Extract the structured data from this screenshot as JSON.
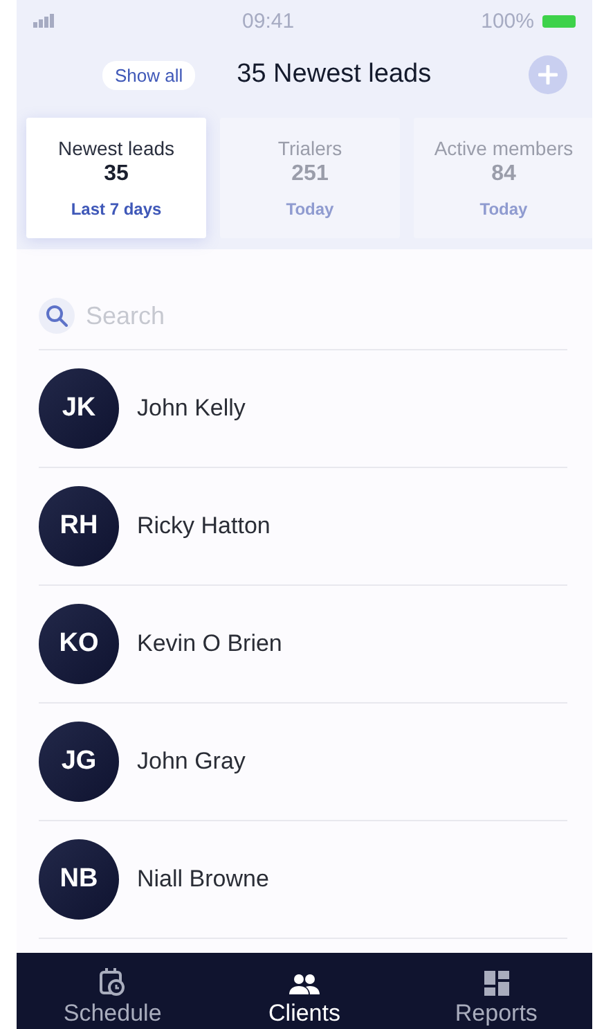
{
  "status_bar": {
    "time": "09:41",
    "battery": "100%"
  },
  "header": {
    "show_all": "Show all",
    "title": "35 Newest leads"
  },
  "cards": [
    {
      "label": "Newest leads",
      "count": "35",
      "period": "Last 7 days",
      "selected": true
    },
    {
      "label": "Trialers",
      "count": "251",
      "period": "Today",
      "selected": false
    },
    {
      "label": "Active members",
      "count": "84",
      "period": "Today",
      "selected": false
    }
  ],
  "search": {
    "placeholder": "Search"
  },
  "clients": [
    {
      "initials": "JK",
      "name": "John Kelly"
    },
    {
      "initials": "RH",
      "name": "Ricky Hatton"
    },
    {
      "initials": "KO",
      "name": "Kevin O Brien"
    },
    {
      "initials": "JG",
      "name": "John Gray"
    },
    {
      "initials": "NB",
      "name": "Niall Browne"
    }
  ],
  "nav": [
    {
      "kind": "schedule",
      "label": "Schedule",
      "selected": false
    },
    {
      "kind": "clients",
      "label": "Clients",
      "selected": true
    },
    {
      "kind": "reports",
      "label": "Reports",
      "selected": false
    }
  ]
}
